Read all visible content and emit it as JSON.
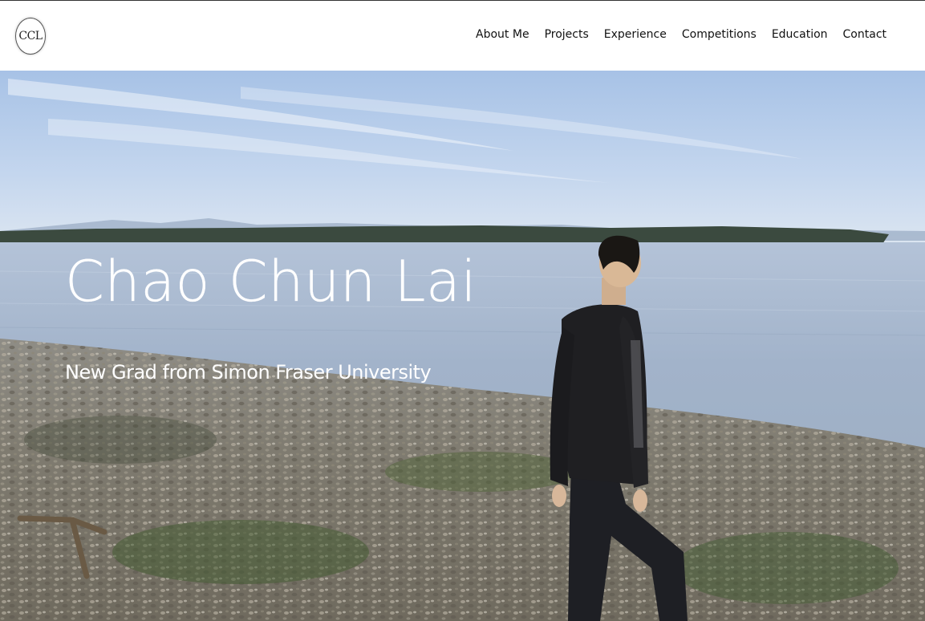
{
  "header": {
    "logo_text": "CCL",
    "nav": [
      {
        "label": "About Me"
      },
      {
        "label": "Projects"
      },
      {
        "label": "Experience"
      },
      {
        "label": "Competitions"
      },
      {
        "label": "Education"
      },
      {
        "label": "Contact"
      }
    ]
  },
  "hero": {
    "title": "Chao Chun Lai",
    "subtitle": "New Grad from Simon Fraser University"
  },
  "colors": {
    "sky": "#b9cfe8",
    "water": "#a9b9cf",
    "beach": "#8a8678",
    "text": "#ffffff",
    "nav_text": "#111111"
  }
}
